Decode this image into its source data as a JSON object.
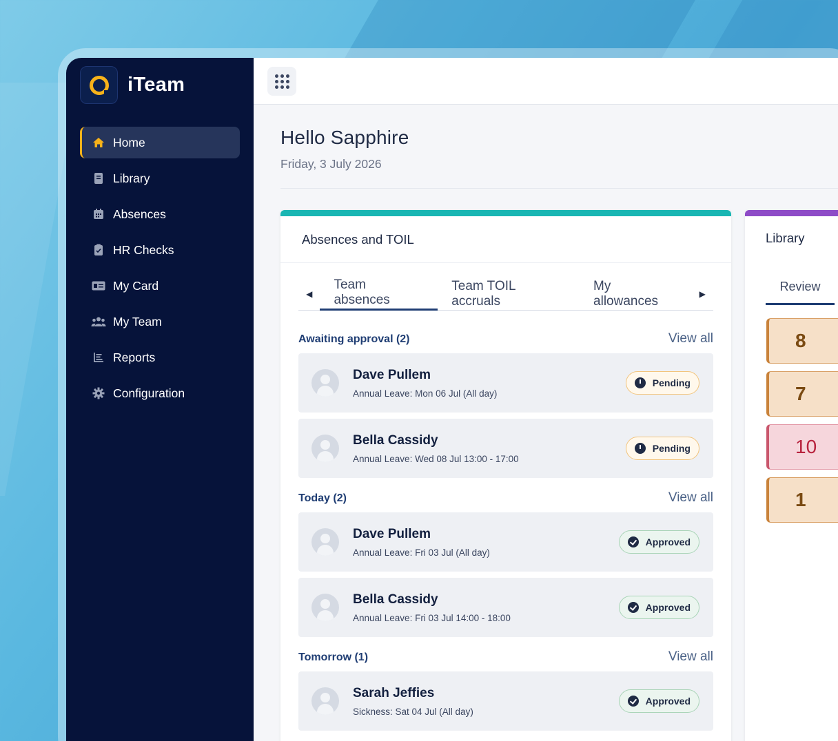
{
  "brand": {
    "name": "iTeam"
  },
  "sidebar": {
    "items": [
      {
        "label": "Home",
        "icon": "home-icon",
        "active": true
      },
      {
        "label": "Library",
        "icon": "book-icon"
      },
      {
        "label": "Absences",
        "icon": "calendar-icon"
      },
      {
        "label": "HR Checks",
        "icon": "clipboard-icon"
      },
      {
        "label": "My Card",
        "icon": "id-card-icon"
      },
      {
        "label": "My Team",
        "icon": "team-icon"
      },
      {
        "label": "Reports",
        "icon": "report-icon"
      },
      {
        "label": "Configuration",
        "icon": "gear-icon"
      }
    ]
  },
  "header": {
    "greeting": "Hello Sapphire",
    "date": "Friday, 3 July 2026"
  },
  "absences_card": {
    "title": "Absences and TOIL",
    "tabs": [
      "Team absences",
      "Team TOIL accruals",
      "My allowances"
    ],
    "sections": [
      {
        "title": "Awaiting approval (2)",
        "link": "View all",
        "rows": [
          {
            "name": "Dave Pullem",
            "detail": "Annual Leave: Mon 06 Jul (All day)",
            "status": "Pending"
          },
          {
            "name": "Bella Cassidy",
            "detail": "Annual Leave: Wed 08 Jul 13:00 - 17:00",
            "status": "Pending"
          }
        ]
      },
      {
        "title": "Today (2)",
        "link": "View all",
        "rows": [
          {
            "name": "Dave Pullem",
            "detail": "Annual Leave: Fri 03 Jul (All day)",
            "status": "Approved"
          },
          {
            "name": "Bella Cassidy",
            "detail": "Annual Leave: Fri 03 Jul 14:00 - 18:00",
            "status": "Approved"
          }
        ]
      },
      {
        "title": "Tomorrow (1)",
        "link": "View all",
        "rows": [
          {
            "name": "Sarah Jeffies",
            "detail": "Sickness: Sat 04 Jul (All day)",
            "status": "Approved"
          }
        ]
      }
    ]
  },
  "library_card": {
    "title": "Library",
    "tab": "Review",
    "tiles": [
      "8",
      "7",
      "10",
      "1"
    ]
  },
  "colors": {
    "sidebar": "#06133a",
    "accent_yellow": "#f7b21a",
    "absences_accent": "#19b6b3",
    "library_accent": "#8e4bc7"
  }
}
